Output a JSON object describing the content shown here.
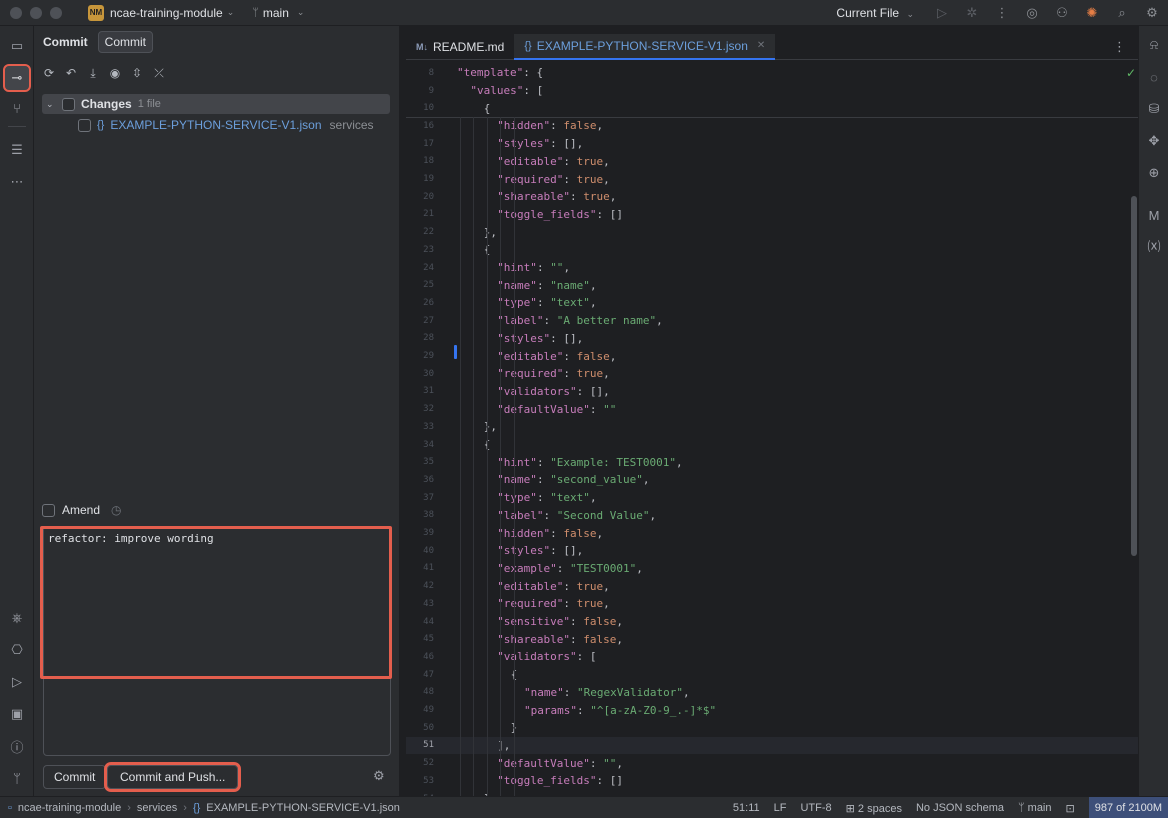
{
  "titlebar": {
    "project_badge": "NM",
    "project_name": "ncae-training-module",
    "branch": "main",
    "run_config": "Current File"
  },
  "commit_panel": {
    "title": "Commit",
    "tab_label": "Commit",
    "changes_label": "Changes",
    "changes_count": "1 file",
    "file_name": "EXAMPLE-PYTHON-SERVICE-V1.json",
    "file_dir": "services",
    "amend_label": "Amend",
    "commit_message": "refactor: improve wording",
    "commit_button": "Commit",
    "commit_push_button": "Commit and Push..."
  },
  "editor": {
    "tabs": [
      {
        "label": "README.md",
        "icon": "markdown-icon"
      },
      {
        "label": "EXAMPLE-PYTHON-SERVICE-V1.json",
        "icon": "json-icon"
      }
    ],
    "md_icon_text": "M↓",
    "lines": [
      {
        "n": "8",
        "indent": 2,
        "tokens": [
          [
            "k",
            "\"template\""
          ],
          [
            "p",
            ": {"
          ]
        ]
      },
      {
        "n": "9",
        "indent": 3,
        "tokens": [
          [
            "k",
            "\"values\""
          ],
          [
            "p",
            ": ["
          ]
        ]
      },
      {
        "n": "10",
        "indent": 4,
        "tokens": [
          [
            "p",
            "{"
          ]
        ]
      },
      {
        "n": "16",
        "indent": 5,
        "tokens": [
          [
            "k",
            "\"hidden\""
          ],
          [
            "p",
            ": "
          ],
          [
            "kw",
            "false"
          ],
          [
            "p",
            ","
          ]
        ]
      },
      {
        "n": "17",
        "indent": 5,
        "tokens": [
          [
            "k",
            "\"styles\""
          ],
          [
            "p",
            ": [],"
          ]
        ]
      },
      {
        "n": "18",
        "indent": 5,
        "tokens": [
          [
            "k",
            "\"editable\""
          ],
          [
            "p",
            ": "
          ],
          [
            "kw",
            "true"
          ],
          [
            "p",
            ","
          ]
        ]
      },
      {
        "n": "19",
        "indent": 5,
        "tokens": [
          [
            "k",
            "\"required\""
          ],
          [
            "p",
            ": "
          ],
          [
            "kw",
            "true"
          ],
          [
            "p",
            ","
          ]
        ]
      },
      {
        "n": "20",
        "indent": 5,
        "tokens": [
          [
            "k",
            "\"shareable\""
          ],
          [
            "p",
            ": "
          ],
          [
            "kw",
            "true"
          ],
          [
            "p",
            ","
          ]
        ]
      },
      {
        "n": "21",
        "indent": 5,
        "tokens": [
          [
            "k",
            "\"toggle_fields\""
          ],
          [
            "p",
            ": []"
          ]
        ]
      },
      {
        "n": "22",
        "indent": 4,
        "tokens": [
          [
            "p",
            "},"
          ]
        ]
      },
      {
        "n": "23",
        "indent": 4,
        "tokens": [
          [
            "p",
            "{"
          ]
        ]
      },
      {
        "n": "24",
        "indent": 5,
        "tokens": [
          [
            "k",
            "\"hint\""
          ],
          [
            "p",
            ": "
          ],
          [
            "s",
            "\"\""
          ],
          [
            "p",
            ","
          ]
        ]
      },
      {
        "n": "25",
        "indent": 5,
        "tokens": [
          [
            "k",
            "\"name\""
          ],
          [
            "p",
            ": "
          ],
          [
            "s",
            "\"name\""
          ],
          [
            "p",
            ","
          ]
        ]
      },
      {
        "n": "26",
        "indent": 5,
        "tokens": [
          [
            "k",
            "\"type\""
          ],
          [
            "p",
            ": "
          ],
          [
            "s",
            "\"text\""
          ],
          [
            "p",
            ","
          ]
        ]
      },
      {
        "n": "27",
        "indent": 5,
        "tokens": [
          [
            "k",
            "\"label\""
          ],
          [
            "p",
            ": "
          ],
          [
            "s",
            "\"A better name\""
          ],
          [
            "p",
            ","
          ]
        ]
      },
      {
        "n": "28",
        "indent": 5,
        "tokens": [
          [
            "k",
            "\"styles\""
          ],
          [
            "p",
            ": [],"
          ]
        ]
      },
      {
        "n": "29",
        "indent": 5,
        "tokens": [
          [
            "k",
            "\"editable\""
          ],
          [
            "p",
            ": "
          ],
          [
            "kw",
            "false"
          ],
          [
            "p",
            ","
          ]
        ]
      },
      {
        "n": "30",
        "indent": 5,
        "tokens": [
          [
            "k",
            "\"required\""
          ],
          [
            "p",
            ": "
          ],
          [
            "kw",
            "true"
          ],
          [
            "p",
            ","
          ]
        ]
      },
      {
        "n": "31",
        "indent": 5,
        "tokens": [
          [
            "k",
            "\"validators\""
          ],
          [
            "p",
            ": [],"
          ]
        ]
      },
      {
        "n": "32",
        "indent": 5,
        "tokens": [
          [
            "k",
            "\"defaultValue\""
          ],
          [
            "p",
            ": "
          ],
          [
            "s",
            "\"\""
          ]
        ]
      },
      {
        "n": "33",
        "indent": 4,
        "tokens": [
          [
            "p",
            "},"
          ]
        ]
      },
      {
        "n": "34",
        "indent": 4,
        "tokens": [
          [
            "p",
            "{"
          ]
        ]
      },
      {
        "n": "35",
        "indent": 5,
        "tokens": [
          [
            "k",
            "\"hint\""
          ],
          [
            "p",
            ": "
          ],
          [
            "s",
            "\"Example: TEST0001\""
          ],
          [
            "p",
            ","
          ]
        ]
      },
      {
        "n": "36",
        "indent": 5,
        "tokens": [
          [
            "k",
            "\"name\""
          ],
          [
            "p",
            ": "
          ],
          [
            "s",
            "\"second_value\""
          ],
          [
            "p",
            ","
          ]
        ]
      },
      {
        "n": "37",
        "indent": 5,
        "tokens": [
          [
            "k",
            "\"type\""
          ],
          [
            "p",
            ": "
          ],
          [
            "s",
            "\"text\""
          ],
          [
            "p",
            ","
          ]
        ]
      },
      {
        "n": "38",
        "indent": 5,
        "tokens": [
          [
            "k",
            "\"label\""
          ],
          [
            "p",
            ": "
          ],
          [
            "s",
            "\"Second Value\""
          ],
          [
            "p",
            ","
          ]
        ]
      },
      {
        "n": "39",
        "indent": 5,
        "tokens": [
          [
            "k",
            "\"hidden\""
          ],
          [
            "p",
            ": "
          ],
          [
            "kw",
            "false"
          ],
          [
            "p",
            ","
          ]
        ]
      },
      {
        "n": "40",
        "indent": 5,
        "tokens": [
          [
            "k",
            "\"styles\""
          ],
          [
            "p",
            ": [],"
          ]
        ]
      },
      {
        "n": "41",
        "indent": 5,
        "tokens": [
          [
            "k",
            "\"example\""
          ],
          [
            "p",
            ": "
          ],
          [
            "s",
            "\"TEST0001\""
          ],
          [
            "p",
            ","
          ]
        ]
      },
      {
        "n": "42",
        "indent": 5,
        "tokens": [
          [
            "k",
            "\"editable\""
          ],
          [
            "p",
            ": "
          ],
          [
            "kw",
            "true"
          ],
          [
            "p",
            ","
          ]
        ]
      },
      {
        "n": "43",
        "indent": 5,
        "tokens": [
          [
            "k",
            "\"required\""
          ],
          [
            "p",
            ": "
          ],
          [
            "kw",
            "true"
          ],
          [
            "p",
            ","
          ]
        ]
      },
      {
        "n": "44",
        "indent": 5,
        "tokens": [
          [
            "k",
            "\"sensitive\""
          ],
          [
            "p",
            ": "
          ],
          [
            "kw",
            "false"
          ],
          [
            "p",
            ","
          ]
        ]
      },
      {
        "n": "45",
        "indent": 5,
        "tokens": [
          [
            "k",
            "\"shareable\""
          ],
          [
            "p",
            ": "
          ],
          [
            "kw",
            "false"
          ],
          [
            "p",
            ","
          ]
        ]
      },
      {
        "n": "46",
        "indent": 5,
        "tokens": [
          [
            "k",
            "\"validators\""
          ],
          [
            "p",
            ": ["
          ]
        ]
      },
      {
        "n": "47",
        "indent": 6,
        "tokens": [
          [
            "p",
            "{"
          ]
        ]
      },
      {
        "n": "48",
        "indent": 7,
        "tokens": [
          [
            "k",
            "\"name\""
          ],
          [
            "p",
            ": "
          ],
          [
            "s",
            "\"RegexValidator\""
          ],
          [
            "p",
            ","
          ]
        ]
      },
      {
        "n": "49",
        "indent": 7,
        "tokens": [
          [
            "k",
            "\"params\""
          ],
          [
            "p",
            ": "
          ],
          [
            "s",
            "\"^[a-zA-Z0-9_.-]*$\""
          ]
        ]
      },
      {
        "n": "50",
        "indent": 6,
        "tokens": [
          [
            "p",
            "}"
          ]
        ]
      },
      {
        "n": "51",
        "indent": 5,
        "tokens": [
          [
            "p",
            "],"
          ]
        ],
        "current": true
      },
      {
        "n": "52",
        "indent": 5,
        "tokens": [
          [
            "k",
            "\"defaultValue\""
          ],
          [
            "p",
            ": "
          ],
          [
            "s",
            "\"\""
          ],
          [
            "p",
            ","
          ]
        ]
      },
      {
        "n": "53",
        "indent": 5,
        "tokens": [
          [
            "k",
            "\"toggle_fields\""
          ],
          [
            "p",
            ": []"
          ]
        ]
      },
      {
        "n": "54",
        "indent": 4,
        "tokens": [
          [
            "p",
            "}"
          ]
        ]
      }
    ]
  },
  "statusbar": {
    "crumb_project": "ncae-training-module",
    "crumb_dir": "services",
    "crumb_file": "EXAMPLE-PYTHON-SERVICE-V1.json",
    "position": "51:11",
    "line_sep": "LF",
    "encoding": "UTF-8",
    "indent": "2 spaces",
    "schema": "No JSON schema",
    "branch": "main",
    "memory": "987 of 2100M"
  },
  "colors": {
    "accent": "#3574f0",
    "highlight": "#e45e4d",
    "json_key": "#c77dbb",
    "json_string": "#6aab73",
    "json_keyword": "#cf8e6d"
  }
}
